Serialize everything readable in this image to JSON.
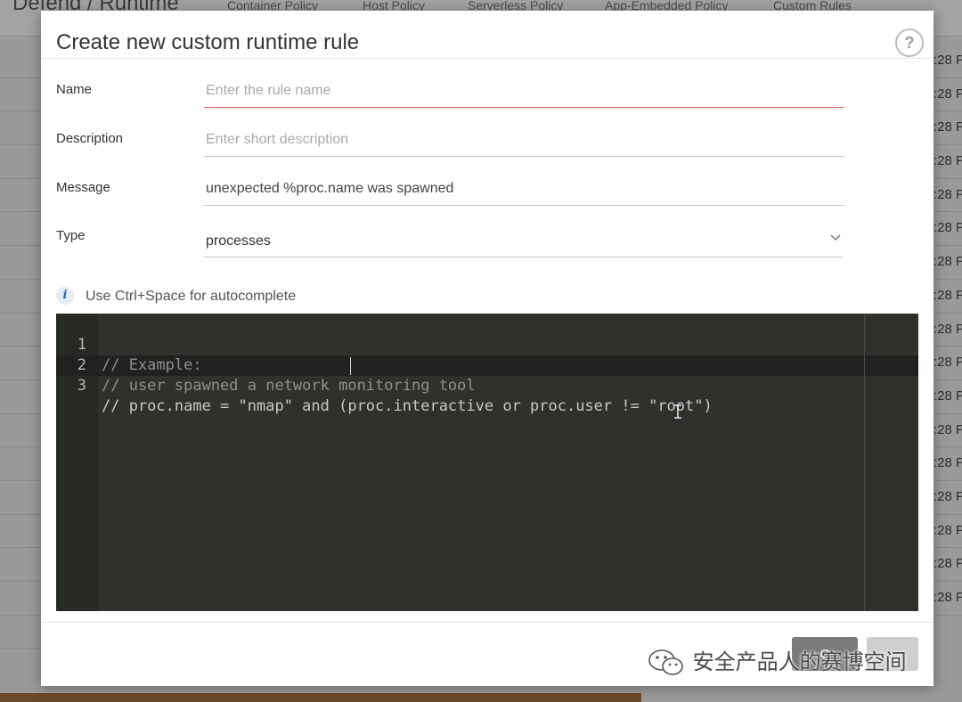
{
  "background": {
    "page_title": "Defend / Runtime",
    "tabs": [
      "Container Policy",
      "Host Policy",
      "Serverless Policy",
      "App-Embedded Policy",
      "Custom Rules"
    ],
    "row_time_fragment": ":28 P"
  },
  "modal": {
    "title": "Create new custom runtime rule",
    "help_label": "?",
    "fields": {
      "name": {
        "label": "Name",
        "value": "",
        "placeholder": "Enter the rule name"
      },
      "description": {
        "label": "Description",
        "value": "",
        "placeholder": "Enter short description"
      },
      "message": {
        "label": "Message",
        "value": "unexpected %proc.name was spawned",
        "placeholder": ""
      },
      "type": {
        "label": "Type",
        "selected": "processes"
      }
    },
    "hint": {
      "icon": "info-icon",
      "text": "Use Ctrl+Space for autocomplete"
    },
    "editor": {
      "lines": [
        {
          "number": "1",
          "code": "// Example:"
        },
        {
          "number": "2",
          "code": "// user spawned a network monitoring tool"
        },
        {
          "number": "3",
          "code": "// proc.name = \"nmap\" and (proc.interactive or proc.user != \"root\")"
        }
      ]
    },
    "buttons": {
      "primary": "C",
      "secondary": ""
    }
  },
  "watermark": {
    "text": "安全产品人的赛博空间",
    "icon": "wechat-icon"
  },
  "colors": {
    "editor_bg": "#2f312c",
    "active_input_underline": "#e0604a",
    "info_icon": "#2f5f9c"
  }
}
